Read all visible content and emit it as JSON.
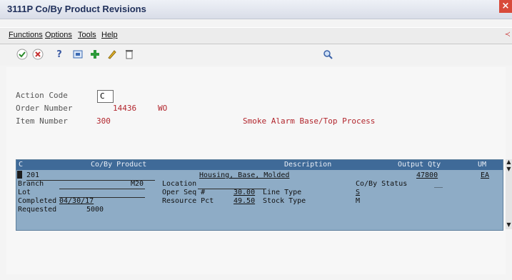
{
  "window": {
    "title": "3111P  Co/By Product Revisions",
    "close": "×"
  },
  "menu": {
    "items": [
      "Functions",
      "Options",
      "Tools",
      "Help"
    ],
    "right_mark": "≺"
  },
  "toolbar": {
    "icons": [
      "ok",
      "cancel",
      "help",
      "new",
      "add",
      "edit",
      "delete",
      "find"
    ]
  },
  "header_fields": {
    "action_code_label": "Action Code",
    "action_code_value": "C",
    "order_number_label": "Order Number",
    "order_number_value": "14436",
    "order_type": "WO",
    "item_number_label": "Item Number",
    "item_number_value": "300",
    "item_description": "Smoke Alarm Base/Top Process"
  },
  "grid": {
    "headers": [
      "C",
      "Co/By Product",
      "Description",
      "Output Qty",
      "UM"
    ],
    "row1": {
      "product": "201",
      "description": "Housing, Base, Molded",
      "output_qty": "47800",
      "um": "EA"
    },
    "branch_label": "Branch",
    "branch_value": "M20",
    "location_label": "Location",
    "co_by_status_label": "Co/By Status",
    "co_by_status_value": "__",
    "lot_label": "Lot",
    "oper_seq_label": "Oper Seq #",
    "oper_seq_value": "30.00",
    "line_type_label": "Line Type",
    "line_type_value": "S",
    "completed_label": "Completed",
    "completed_value": "04/30/17",
    "resource_pct_label": "Resource Pct",
    "resource_pct_value": "49.50",
    "stock_type_label": "Stock Type",
    "stock_type_value": "M",
    "requested_label": "Requested",
    "requested_value": "5000"
  },
  "colors": {
    "title_text": "#1f2f5a",
    "header_bar": "#3f6a98",
    "grid_bg": "#8eacc6",
    "accent_red": "#b2262d"
  }
}
